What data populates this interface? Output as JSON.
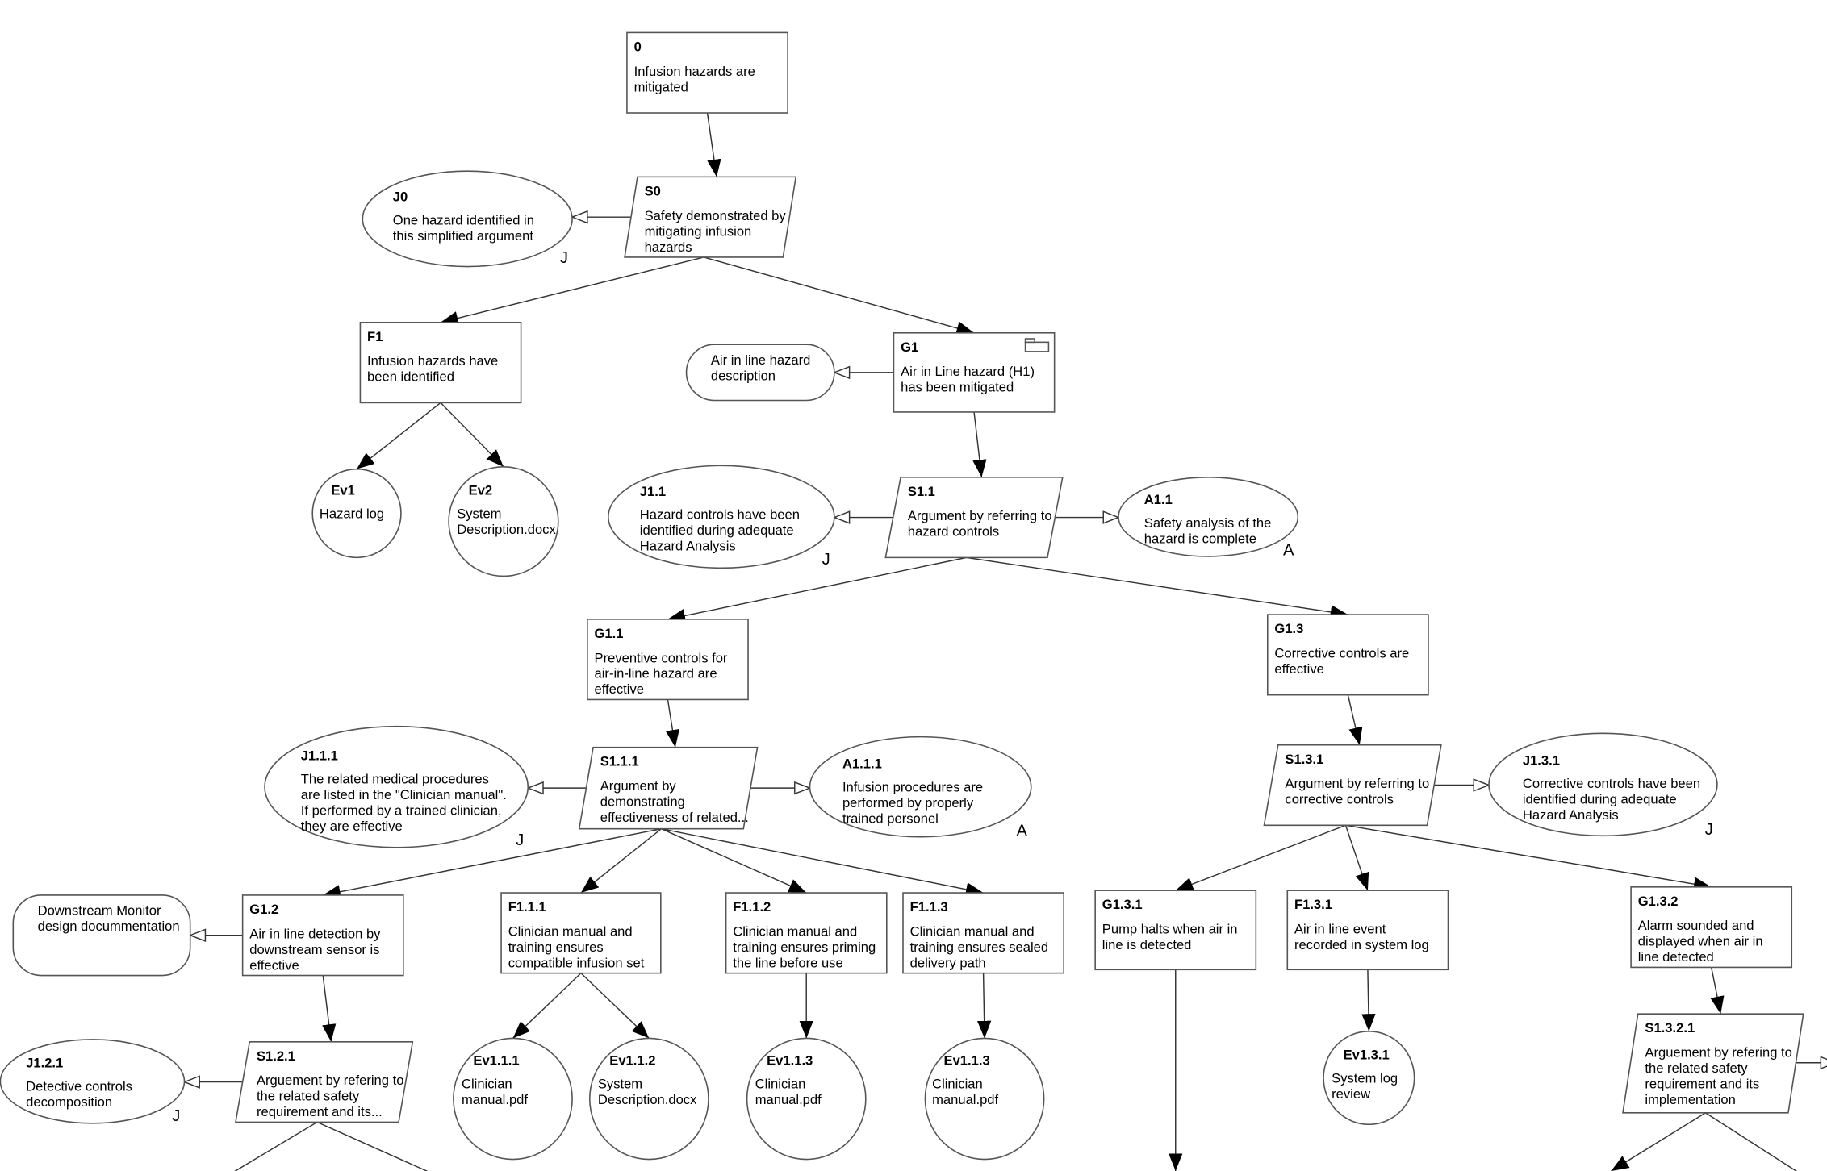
{
  "diagram": {
    "notation": "GSN",
    "colors": {
      "line": "#333333",
      "shape_border": "#555555",
      "background": "#ffffff"
    },
    "nodes": [
      {
        "id": "0",
        "type": "goal",
        "label": "0",
        "lines": [
          "Infusion hazards are",
          "mitigated"
        ]
      },
      {
        "id": "S0",
        "type": "strategy",
        "label": "S0",
        "lines": [
          "Safety demonstrated by",
          "mitigating infusion",
          "hazards"
        ]
      },
      {
        "id": "J0",
        "type": "justification",
        "label": "J0",
        "lines": [
          "One hazard identified in",
          "this simplified argument"
        ],
        "marker": "J"
      },
      {
        "id": "F1",
        "type": "goal",
        "label": "F1",
        "lines": [
          "Infusion hazards have",
          "been identified"
        ]
      },
      {
        "id": "G1",
        "type": "goal",
        "label": "G1",
        "lines": [
          "Air in Line hazard (H1)",
          "has been mitigated"
        ],
        "icon": "folder-icon"
      },
      {
        "id": "C1",
        "type": "context",
        "label": "",
        "lines": [
          "Air in line hazard",
          "description"
        ]
      },
      {
        "id": "Ev1",
        "type": "evidence",
        "label": "Ev1",
        "lines": [
          "Hazard log"
        ]
      },
      {
        "id": "Ev2",
        "type": "evidence",
        "label": "Ev2",
        "lines": [
          "System",
          "Description.docx"
        ]
      },
      {
        "id": "S1.1",
        "type": "strategy",
        "label": "S1.1",
        "lines": [
          "Argument by referring to",
          "hazard controls"
        ]
      },
      {
        "id": "J1.1",
        "type": "justification",
        "label": "J1.1",
        "lines": [
          "Hazard controls have been",
          "identified during adequate",
          "Hazard Analysis"
        ],
        "marker": "J"
      },
      {
        "id": "A1.1",
        "type": "assumption",
        "label": "A1.1",
        "lines": [
          "Safety analysis of the",
          "hazard is complete"
        ],
        "marker": "A"
      },
      {
        "id": "G1.1",
        "type": "goal",
        "label": "G1.1",
        "lines": [
          "Preventive controls for",
          "air-in-line hazard are",
          "effective"
        ]
      },
      {
        "id": "G1.3",
        "type": "goal",
        "label": "G1.3",
        "lines": [
          "Corrective controls are",
          "effective"
        ]
      },
      {
        "id": "S1.1.1",
        "type": "strategy",
        "label": "S1.1.1",
        "lines": [
          "Argument by",
          "demonstrating",
          "effectiveness of related..."
        ]
      },
      {
        "id": "J1.1.1",
        "type": "justification",
        "label": "J1.1.1",
        "lines": [
          "The related medical procedures",
          "are listed in the \"Clinician manual\".",
          "If performed by a trained clinician,",
          "they are effective"
        ],
        "marker": "J"
      },
      {
        "id": "A1.1.1",
        "type": "assumption",
        "label": "A1.1.1",
        "lines": [
          "Infusion procedures are",
          "performed by properly",
          "trained personel"
        ],
        "marker": "A"
      },
      {
        "id": "S1.3.1",
        "type": "strategy",
        "label": "S1.3.1",
        "lines": [
          "Argument by referring to",
          "corrective controls"
        ]
      },
      {
        "id": "J1.3.1",
        "type": "justification",
        "label": "J1.3.1",
        "lines": [
          "Corrective controls have been",
          "identified during adequate",
          "Hazard Analysis"
        ],
        "marker": "J"
      },
      {
        "id": "G1.2",
        "type": "goal",
        "label": "G1.2",
        "lines": [
          "Air in line detection by",
          "downstream sensor is",
          "effective"
        ]
      },
      {
        "id": "C1.2",
        "type": "context",
        "label": "",
        "lines": [
          "Downstream Monitor",
          "design docummentation"
        ]
      },
      {
        "id": "F1.1.1",
        "type": "goal",
        "label": "F1.1.1",
        "lines": [
          "Clinician manual and",
          "training ensures",
          "compatible infusion set"
        ]
      },
      {
        "id": "F1.1.2",
        "type": "goal",
        "label": "F1.1.2",
        "lines": [
          "Clinician manual and",
          "training ensures priming",
          "the line before use"
        ]
      },
      {
        "id": "F1.1.3",
        "type": "goal",
        "label": "F1.1.3",
        "lines": [
          "Clinician manual and",
          "training ensures sealed",
          "delivery path"
        ]
      },
      {
        "id": "G1.3.1",
        "type": "goal",
        "label": "G1.3.1",
        "lines": [
          "Pump halts when air in",
          "line is detected"
        ]
      },
      {
        "id": "F1.3.1",
        "type": "goal",
        "label": "F1.3.1",
        "lines": [
          "Air in line event",
          "recorded in system log"
        ]
      },
      {
        "id": "G1.3.2",
        "type": "goal",
        "label": "G1.3.2",
        "lines": [
          "Alarm sounded and",
          "displayed when air in",
          "line detected"
        ]
      },
      {
        "id": "S1.2.1",
        "type": "strategy",
        "label": "S1.2.1",
        "lines": [
          "Arguement by refering to",
          "the related safety",
          "requirement and its..."
        ]
      },
      {
        "id": "J1.2.1",
        "type": "justification",
        "label": "J1.2.1",
        "lines": [
          "Detective controls",
          "decomposition"
        ],
        "marker": "J"
      },
      {
        "id": "Ev1.1.1",
        "type": "evidence",
        "label": "Ev1.1.1",
        "lines": [
          "Clinician",
          "manual.pdf"
        ]
      },
      {
        "id": "Ev1.1.2",
        "type": "evidence",
        "label": "Ev1.1.2",
        "lines": [
          "System",
          "Description.docx"
        ]
      },
      {
        "id": "Ev1.1.3a",
        "type": "evidence",
        "label": "Ev1.1.3",
        "lines": [
          "Clinician",
          "manual.pdf"
        ]
      },
      {
        "id": "Ev1.1.3b",
        "type": "evidence",
        "label": "Ev1.1.3",
        "lines": [
          "Clinician",
          "manual.pdf"
        ]
      },
      {
        "id": "Ev1.3.1",
        "type": "evidence",
        "label": "Ev1.3.1",
        "lines": [
          "System log",
          "review"
        ]
      },
      {
        "id": "S1.3.2.1",
        "type": "strategy",
        "label": "S1.3.2.1",
        "lines": [
          "Arguement by refering to",
          "the related safety",
          "requirement and its",
          "implementation"
        ]
      }
    ],
    "links": [
      {
        "from": "0",
        "to": "S0",
        "type": "supported_by"
      },
      {
        "from": "S0",
        "to": "J0",
        "type": "in_context_of"
      },
      {
        "from": "S0",
        "to": "F1",
        "type": "supported_by"
      },
      {
        "from": "S0",
        "to": "G1",
        "type": "supported_by"
      },
      {
        "from": "G1",
        "to": "C1",
        "type": "in_context_of"
      },
      {
        "from": "F1",
        "to": "Ev1",
        "type": "supported_by"
      },
      {
        "from": "F1",
        "to": "Ev2",
        "type": "supported_by"
      },
      {
        "from": "G1",
        "to": "S1.1",
        "type": "supported_by"
      },
      {
        "from": "S1.1",
        "to": "J1.1",
        "type": "in_context_of"
      },
      {
        "from": "S1.1",
        "to": "A1.1",
        "type": "in_context_of"
      },
      {
        "from": "S1.1",
        "to": "G1.1",
        "type": "supported_by"
      },
      {
        "from": "S1.1",
        "to": "G1.3",
        "type": "supported_by"
      },
      {
        "from": "G1.1",
        "to": "S1.1.1",
        "type": "supported_by"
      },
      {
        "from": "S1.1.1",
        "to": "J1.1.1",
        "type": "in_context_of"
      },
      {
        "from": "S1.1.1",
        "to": "A1.1.1",
        "type": "in_context_of"
      },
      {
        "from": "S1.1.1",
        "to": "G1.2",
        "type": "supported_by"
      },
      {
        "from": "S1.1.1",
        "to": "F1.1.1",
        "type": "supported_by"
      },
      {
        "from": "S1.1.1",
        "to": "F1.1.2",
        "type": "supported_by"
      },
      {
        "from": "S1.1.1",
        "to": "F1.1.3",
        "type": "supported_by"
      },
      {
        "from": "G1.2",
        "to": "C1.2",
        "type": "in_context_of"
      },
      {
        "from": "G1.2",
        "to": "S1.2.1",
        "type": "supported_by"
      },
      {
        "from": "S1.2.1",
        "to": "J1.2.1",
        "type": "in_context_of"
      },
      {
        "from": "F1.1.1",
        "to": "Ev1.1.1",
        "type": "supported_by"
      },
      {
        "from": "F1.1.1",
        "to": "Ev1.1.2",
        "type": "supported_by"
      },
      {
        "from": "F1.1.2",
        "to": "Ev1.1.3a",
        "type": "supported_by"
      },
      {
        "from": "F1.1.3",
        "to": "Ev1.1.3b",
        "type": "supported_by"
      },
      {
        "from": "G1.3",
        "to": "S1.3.1",
        "type": "supported_by"
      },
      {
        "from": "S1.3.1",
        "to": "J1.3.1",
        "type": "in_context_of"
      },
      {
        "from": "S1.3.1",
        "to": "G1.3.1",
        "type": "supported_by"
      },
      {
        "from": "S1.3.1",
        "to": "F1.3.1",
        "type": "supported_by"
      },
      {
        "from": "S1.3.1",
        "to": "G1.3.2",
        "type": "supported_by"
      },
      {
        "from": "F1.3.1",
        "to": "Ev1.3.1",
        "type": "supported_by"
      },
      {
        "from": "G1.3.2",
        "to": "S1.3.2.1",
        "type": "supported_by"
      }
    ]
  }
}
